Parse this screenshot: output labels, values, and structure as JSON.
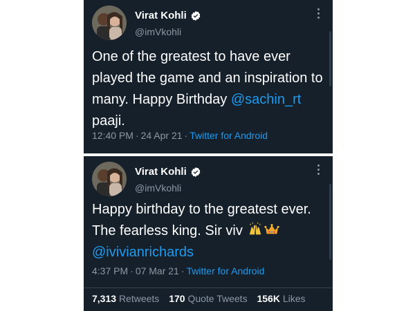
{
  "tweets": [
    {
      "author": {
        "name": "Virat Kohli",
        "handle": "@imVkohli",
        "verified": true
      },
      "text_before": "One of the greatest to have ever played the game and an inspiration to many. Happy Birthday ",
      "mention": "@sachin_rt",
      "text_after": " paaji.",
      "time": "12:40 PM",
      "date": "24 Apr 21",
      "source": "Twitter for Android",
      "separator": "·"
    },
    {
      "author": {
        "name": "Virat Kohli",
        "handle": "@imVkohli",
        "verified": true
      },
      "text_before": "Happy birthday to the greatest ever. The fearless king. Sir viv ",
      "emojis": [
        "raising-hands",
        "crown"
      ],
      "mention": "@ivivianrichards",
      "time": "4:37 PM",
      "date": "07 Mar 21",
      "source": "Twitter for Android",
      "separator": "·",
      "stats": {
        "retweets_count": "7,313",
        "retweets_label": "Retweets",
        "quotes_count": "170",
        "quotes_label": "Quote Tweets",
        "likes_count": "156K",
        "likes_label": "Likes"
      }
    }
  ],
  "colors": {
    "background": "#15202b",
    "text": "#ffffff",
    "secondary": "#8b98a5",
    "link": "#1d9bf0"
  }
}
